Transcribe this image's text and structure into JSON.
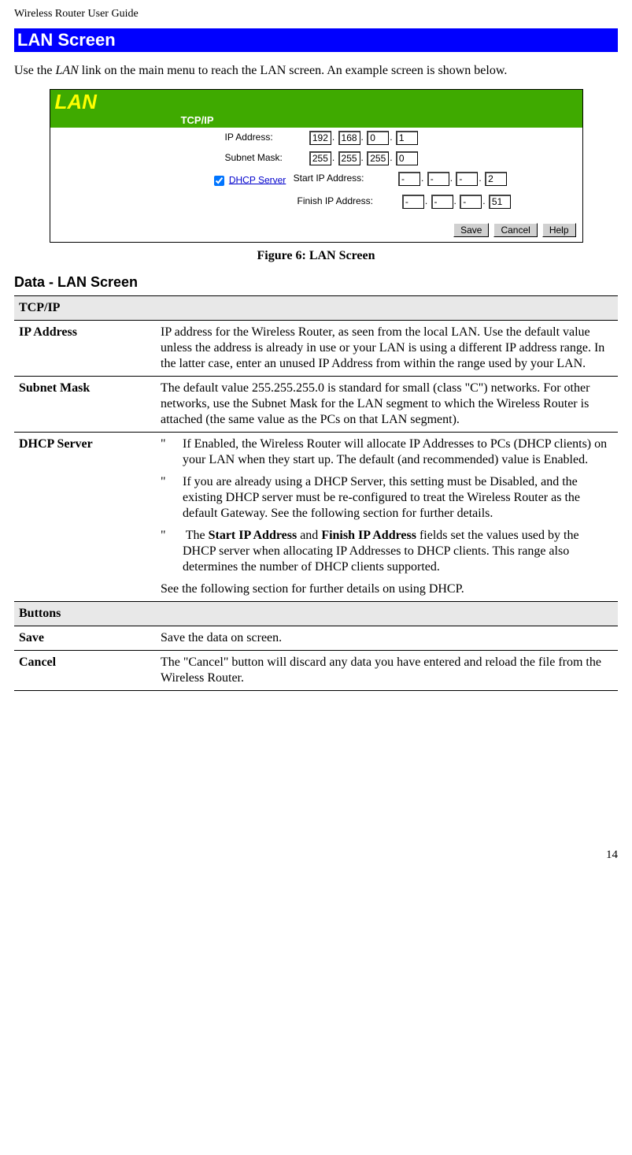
{
  "header": {
    "running": "Wireless Router User Guide"
  },
  "title": "LAN Screen",
  "intro": {
    "pre": "Use the ",
    "link_word": "LAN",
    "post": " link on the main menu to reach the LAN screen. An example screen is shown below."
  },
  "figure": {
    "panel_title": "LAN",
    "section_label": "TCP/IP",
    "rows": {
      "ip_label": "IP Address:",
      "subnet_label": "Subnet Mask:",
      "dhcp_link": "DHCP Server",
      "start_label": "Start IP Address:",
      "finish_label": "Finish IP Address:"
    },
    "ip": [
      "192",
      "168",
      "0",
      "1"
    ],
    "subnet": [
      "255",
      "255",
      "255",
      "0"
    ],
    "start": [
      "-",
      "-",
      "-",
      "2"
    ],
    "finish": [
      "-",
      "-",
      "-",
      "51"
    ],
    "buttons": {
      "save": "Save",
      "cancel": "Cancel",
      "help": "Help"
    },
    "caption": "Figure 6: LAN Screen"
  },
  "data_section": {
    "heading": "Data - LAN Screen",
    "tcpip_header": "TCP/IP",
    "rows": {
      "ip": {
        "label": "IP Address",
        "text": "IP address for the Wireless Router, as seen from the local LAN. Use the default value unless the address is already in use or your LAN is using a different IP address range. In the latter case, enter an unused IP Address from within the range used by your LAN."
      },
      "subnet": {
        "label": "Subnet Mask",
        "text": "The default value 255.255.255.0 is standard for small (class \"C\") networks. For other networks, use the Subnet Mask for the LAN segment to which the Wireless Router is attached (the same value as the PCs on that LAN segment)."
      },
      "dhcp": {
        "label": "DHCP Server",
        "b1": "If Enabled, the Wireless Router will allocate IP Addresses to PCs (DHCP clients) on your LAN when they start up. The default (and recommended) value is Enabled.",
        "b2": "If you are already using a DHCP Server, this setting must be Disabled, and the existing DHCP server must be re-configured to treat the Wireless Router as the default Gateway. See the following section for further details.",
        "b3_pre": "The ",
        "b3_bold1": "Start IP Address",
        "b3_mid": " and ",
        "b3_bold2": "Finish IP Address",
        "b3_post": " fields set the values used by the DHCP server when allocating IP Addresses to DHCP clients. This range also determines the number of DHCP clients supported.",
        "tail": "See the following section for further details on using DHCP."
      }
    },
    "buttons_header": "Buttons",
    "btn_rows": {
      "save": {
        "label": "Save",
        "text": "Save the data on screen."
      },
      "cancel": {
        "label": "Cancel",
        "text": "The \"Cancel\" button will discard any data you have entered and reload the file from the Wireless Router."
      }
    }
  },
  "page_number": "14"
}
